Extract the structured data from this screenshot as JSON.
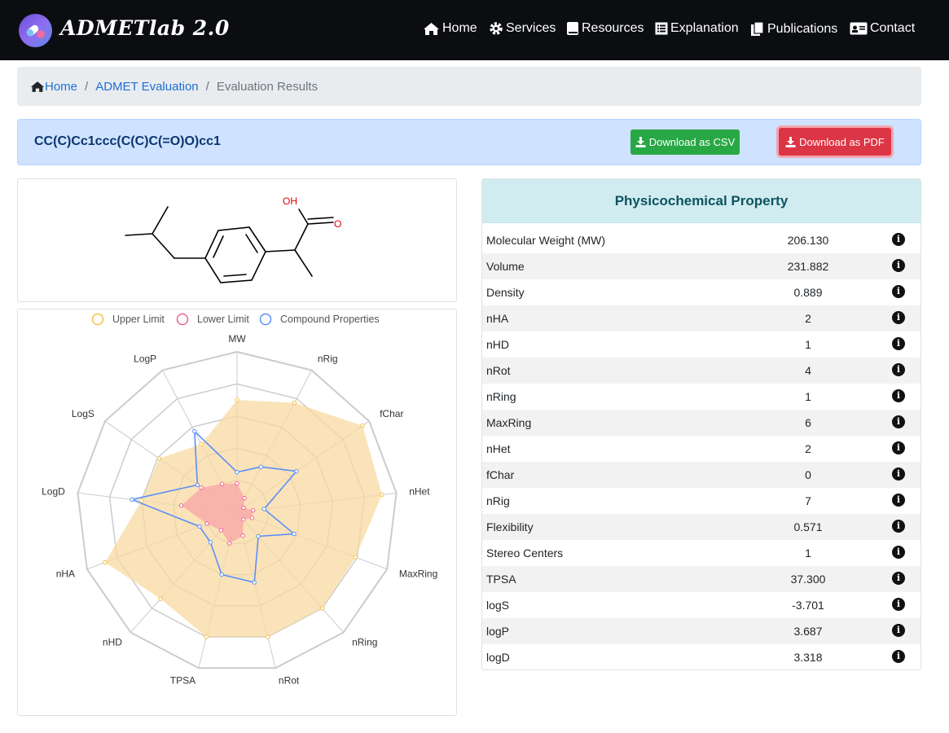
{
  "navbar": {
    "brand": "ADMETlab 2.0",
    "items": [
      {
        "label": "Home",
        "icon": "home-icon"
      },
      {
        "label": "Services",
        "icon": "gear-icon"
      },
      {
        "label": "Resources",
        "icon": "book-icon"
      },
      {
        "label": "Explanation",
        "icon": "list-icon"
      },
      {
        "label": "Publications",
        "icon": "documents-icon"
      },
      {
        "label": "Contact",
        "icon": "id-card-icon"
      }
    ]
  },
  "breadcrumb": {
    "home": "Home",
    "admet": "ADMET Evaluation",
    "current": "Evaluation Results",
    "separator": "/"
  },
  "smiles": "CC(C)Cc1ccc(C(C)C(=O)O)cc1",
  "buttons": {
    "csv": "Download as CSV",
    "pdf": "Download as PDF"
  },
  "structure": {
    "atom_oh": "OH",
    "atom_o": "O"
  },
  "properties": {
    "title": "Physicochemical Property",
    "rows": [
      {
        "name": "Molecular Weight (MW)",
        "value": "206.130"
      },
      {
        "name": "Volume",
        "value": "231.882"
      },
      {
        "name": "Density",
        "value": "0.889"
      },
      {
        "name": "nHA",
        "value": "2"
      },
      {
        "name": "nHD",
        "value": "1"
      },
      {
        "name": "nRot",
        "value": "4"
      },
      {
        "name": "nRing",
        "value": "1"
      },
      {
        "name": "MaxRing",
        "value": "6"
      },
      {
        "name": "nHet",
        "value": "2"
      },
      {
        "name": "fChar",
        "value": "0"
      },
      {
        "name": "nRig",
        "value": "7"
      },
      {
        "name": "Flexibility",
        "value": "0.571"
      },
      {
        "name": "Stereo Centers",
        "value": "1"
      },
      {
        "name": "TPSA",
        "value": "37.300"
      },
      {
        "name": "logS",
        "value": "-3.701"
      },
      {
        "name": "logP",
        "value": "3.687"
      },
      {
        "name": "logD",
        "value": "3.318"
      }
    ]
  },
  "chart_data": {
    "type": "radar",
    "axes": [
      "MW",
      "nRig",
      "fChar",
      "nHet",
      "MaxRing",
      "nRing",
      "nRot",
      "TPSA",
      "nHD",
      "nHA",
      "LogD",
      "LogS",
      "LogP"
    ],
    "max": 1.0,
    "rings": 5,
    "legend": [
      "Upper Limit",
      "Lower Limit",
      "Compound Properties"
    ],
    "series": [
      {
        "name": "Upper Limit",
        "color": "#f5c043",
        "fill": "#f8d9a0",
        "values": [
          0.7,
          0.77,
          0.95,
          0.91,
          0.79,
          0.8,
          0.8,
          0.8,
          0.72,
          0.88,
          0.6,
          0.59,
          0.48
        ]
      },
      {
        "name": "Lower Limit",
        "color": "#f06292",
        "fill": "#f8a7a7",
        "values": [
          0.18,
          0.1,
          0.05,
          0.1,
          0.1,
          0.06,
          0.15,
          0.2,
          0.15,
          0.2,
          0.35,
          0.27,
          0.2
        ]
      },
      {
        "name": "Compound Properties",
        "color": "#5b8ff9",
        "fill": "none",
        "values": [
          0.25,
          0.32,
          0.45,
          0.17,
          0.38,
          0.2,
          0.45,
          0.4,
          0.25,
          0.25,
          0.66,
          0.3,
          0.57
        ]
      }
    ]
  }
}
